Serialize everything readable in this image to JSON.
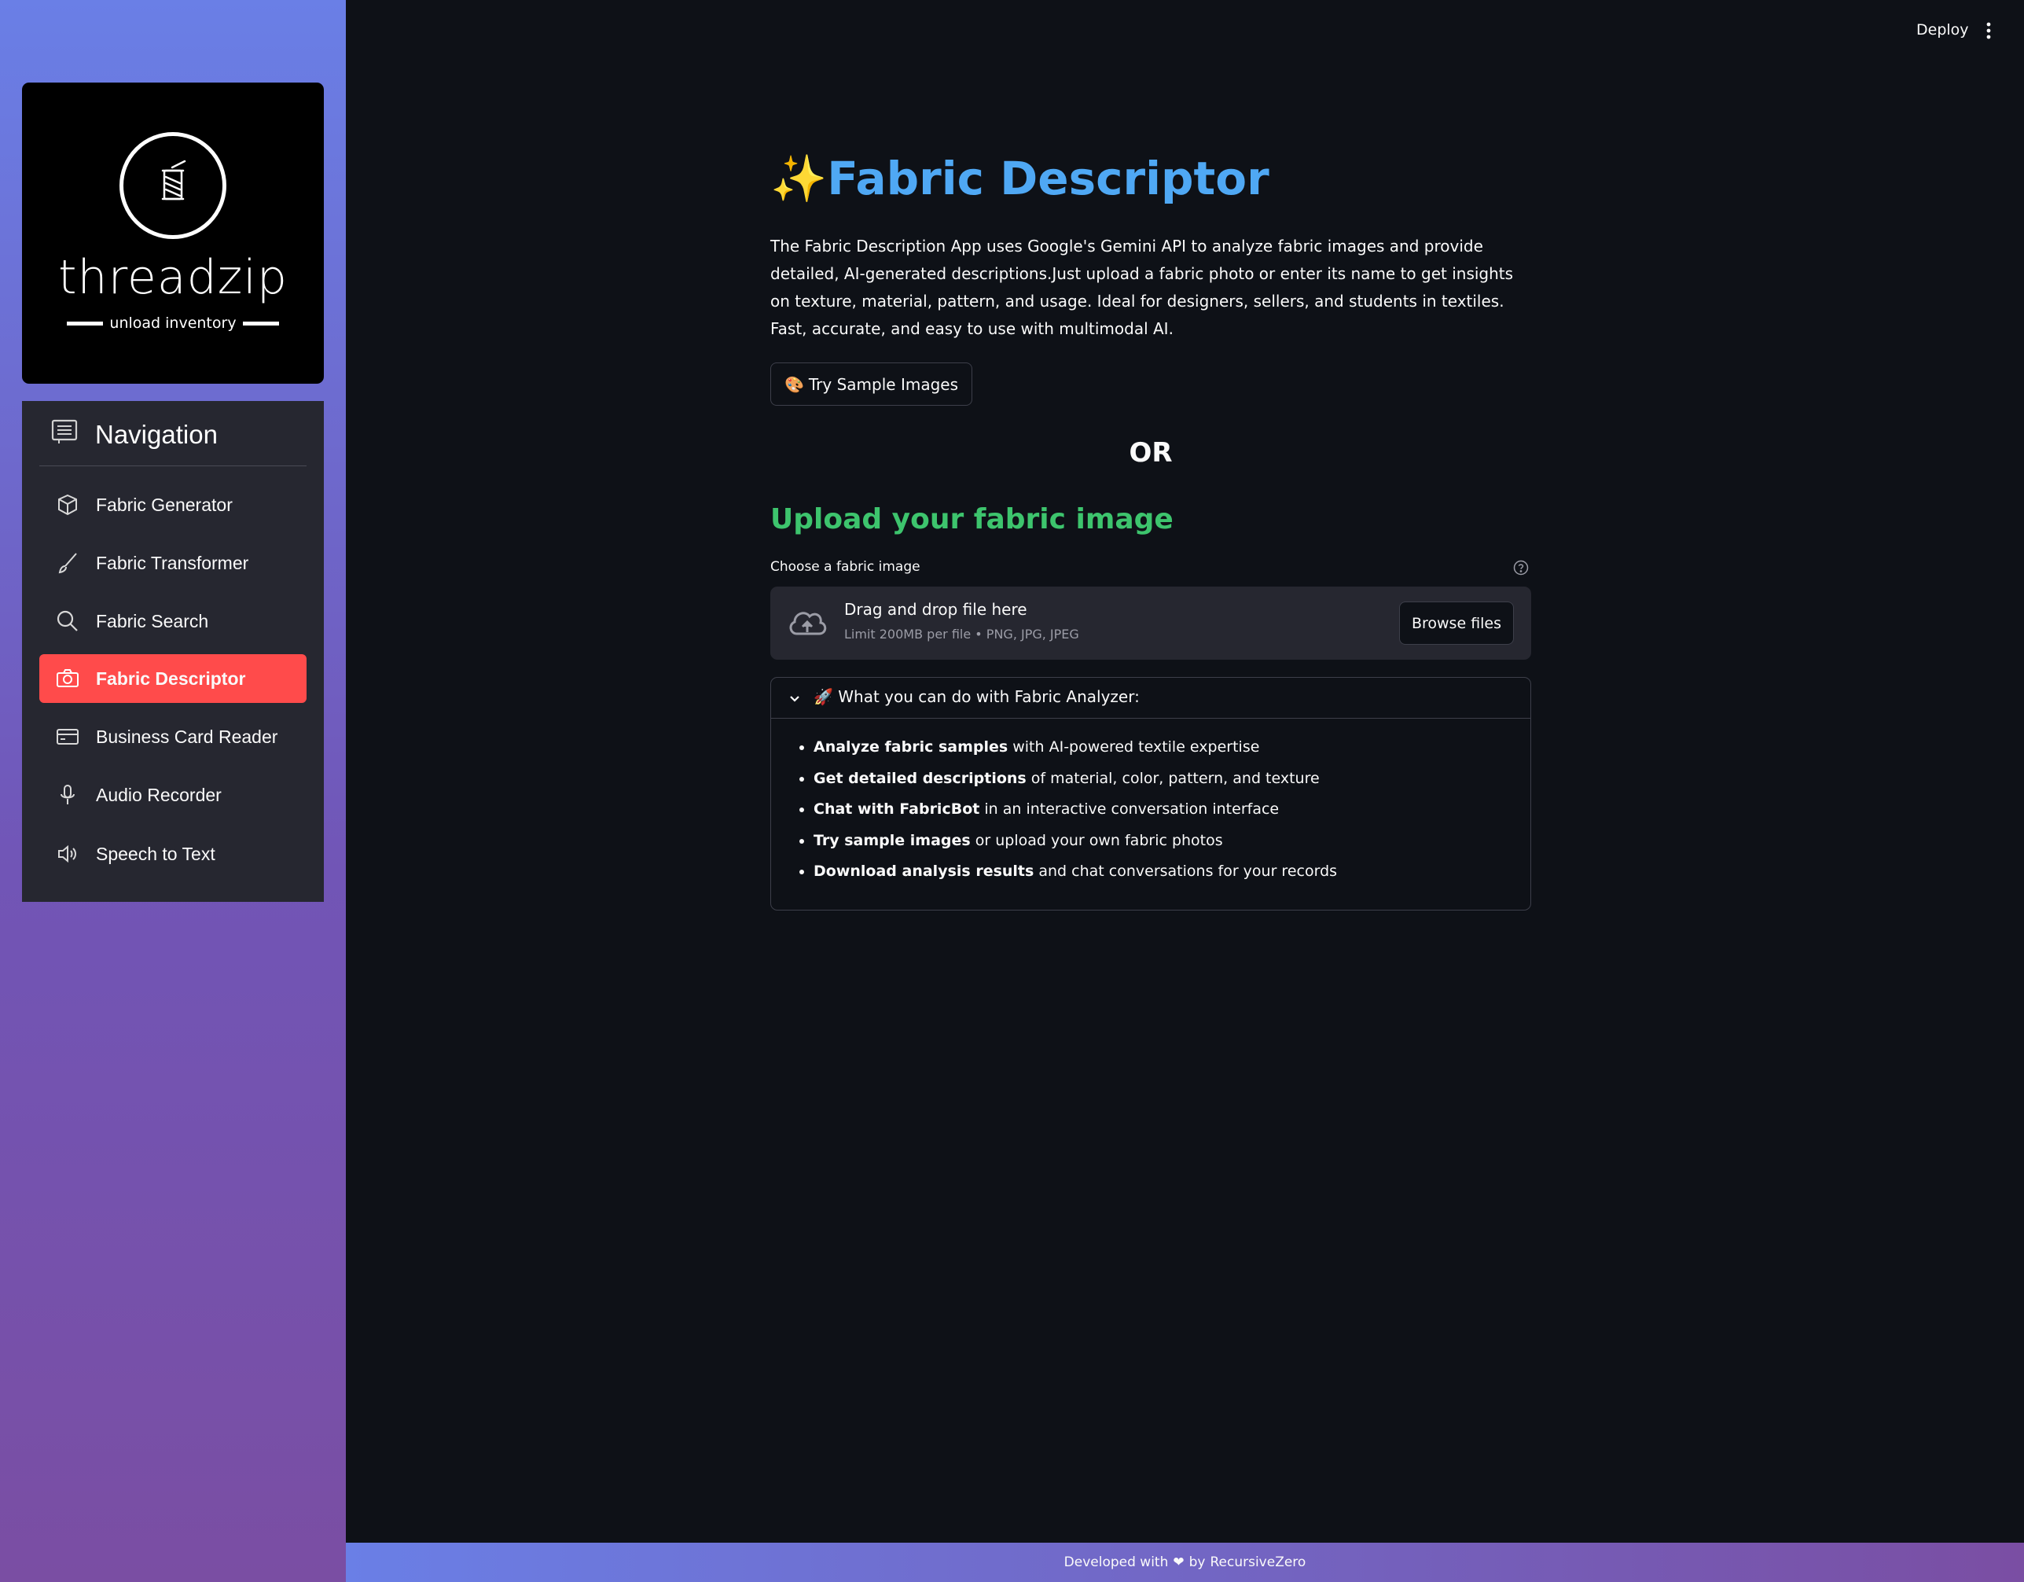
{
  "brand": {
    "name": "threadzip",
    "tagline": "unload inventory"
  },
  "nav": {
    "title": "Navigation",
    "items": [
      {
        "label": "Fabric Generator",
        "icon": "cube-icon"
      },
      {
        "label": "Fabric Transformer",
        "icon": "brush-icon"
      },
      {
        "label": "Fabric Search",
        "icon": "search-icon"
      },
      {
        "label": "Fabric Descriptor",
        "icon": "camera-icon",
        "active": true
      },
      {
        "label": "Business Card Reader",
        "icon": "card-icon"
      },
      {
        "label": "Audio Recorder",
        "icon": "microphone-icon"
      },
      {
        "label": "Speech to Text",
        "icon": "speaker-icon"
      }
    ],
    "active_color": "#ff4b4b"
  },
  "topbar": {
    "deploy_label": "Deploy"
  },
  "main": {
    "title_emoji": "✨",
    "title": "Fabric Descriptor",
    "title_color": "#4fa8f4",
    "description": "The Fabric Description App uses Google's Gemini API to analyze fabric images and provide detailed, AI-generated descriptions.Just upload a fabric photo or enter its name to get insights on texture, material, pattern, and usage. Ideal for designers, sellers, and students in textiles. Fast, accurate, and easy to use with multimodal AI.",
    "sample_button_emoji": "🎨",
    "sample_button": "Try Sample Images",
    "or_text": "OR",
    "upload_heading": "Upload your fabric image",
    "upload_heading_color": "#3dc46d",
    "uploader": {
      "label": "Choose a fabric image",
      "drop_text": "Drag and drop file here",
      "limit_text": "Limit 200MB per file • PNG, JPG, JPEG",
      "browse_button": "Browse files"
    },
    "expander": {
      "title_emoji": "🚀",
      "title": "What you can do with Fabric Analyzer:",
      "items": [
        {
          "bold": "Analyze fabric samples",
          "rest": " with AI-powered textile expertise"
        },
        {
          "bold": "Get detailed descriptions",
          "rest": " of material, color, pattern, and texture"
        },
        {
          "bold": "Chat with FabricBot",
          "rest": " in an interactive conversation interface"
        },
        {
          "bold": "Try sample images",
          "rest": " or upload your own fabric photos"
        },
        {
          "bold": "Download analysis results",
          "rest": " and chat conversations for your records"
        }
      ]
    }
  },
  "footer": {
    "prefix": "Developed with",
    "heart": "❤",
    "by": "by",
    "author": "RecursiveZero"
  }
}
